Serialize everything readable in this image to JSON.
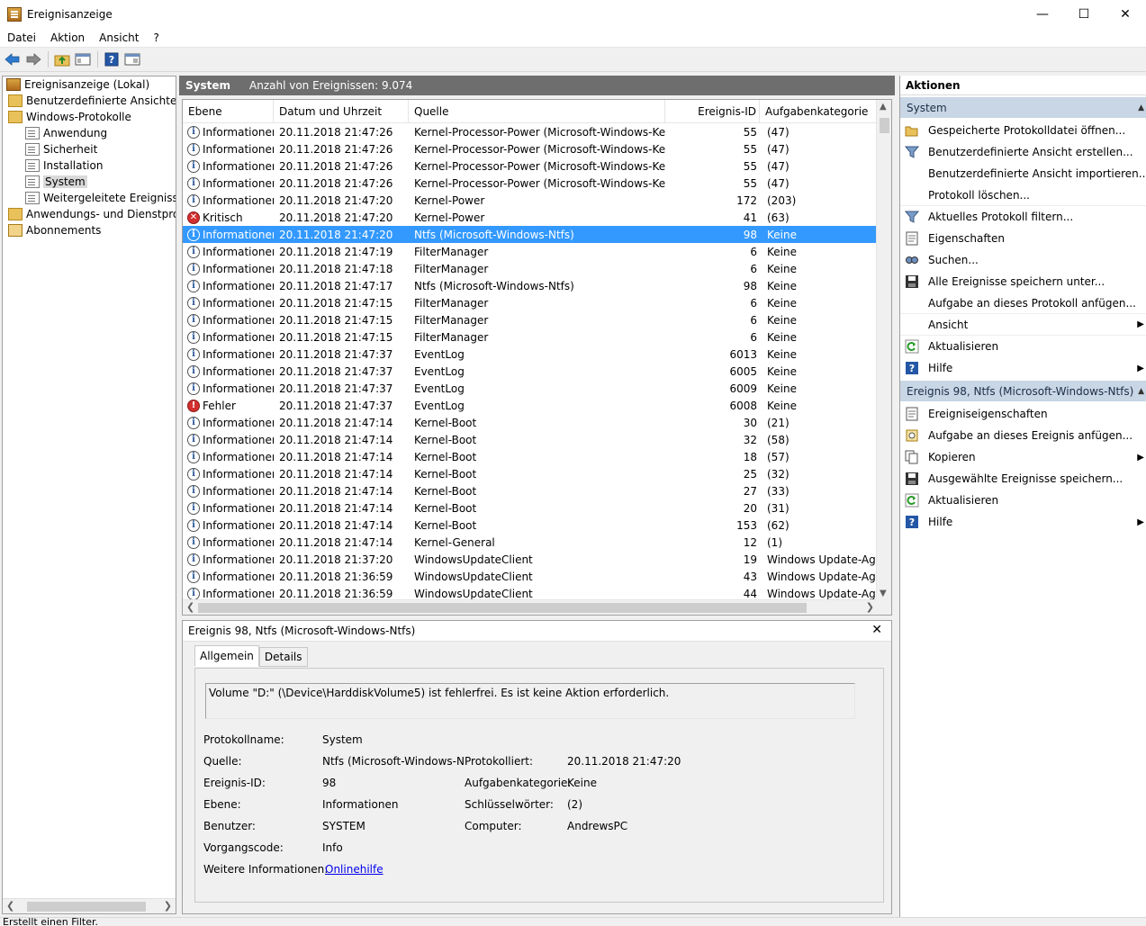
{
  "window": {
    "title": "Ereignisanzeige",
    "minimize": "—",
    "maximize": "☐",
    "close": "✕"
  },
  "menu": [
    "Datei",
    "Aktion",
    "Ansicht",
    "?"
  ],
  "tree": [
    {
      "label": "Ereignisanzeige (Lokal)",
      "indent": 0,
      "icon": "eventviewer-icon"
    },
    {
      "label": "Benutzerdefinierte Ansichten",
      "indent": 1,
      "icon": "folder-icon"
    },
    {
      "label": "Windows-Protokolle",
      "indent": 1,
      "icon": "folder-icon"
    },
    {
      "label": "Anwendung",
      "indent": 2,
      "icon": "log-icon"
    },
    {
      "label": "Sicherheit",
      "indent": 2,
      "icon": "log-icon"
    },
    {
      "label": "Installation",
      "indent": 2,
      "icon": "log-icon"
    },
    {
      "label": "System",
      "indent": 2,
      "icon": "log-icon",
      "selected": true
    },
    {
      "label": "Weitergeleitete Ereignisse",
      "indent": 2,
      "icon": "log-icon"
    },
    {
      "label": "Anwendungs- und Dienstprotokolle",
      "indent": 1,
      "icon": "folder-icon"
    },
    {
      "label": "Abonnements",
      "indent": 1,
      "icon": "subscription-icon"
    }
  ],
  "center": {
    "log_name": "System",
    "count_text": "Anzahl von Ereignissen: 9.074"
  },
  "columns": [
    "Ebene",
    "Datum und Uhrzeit",
    "Quelle",
    "Ereignis-ID",
    "Aufgabenkategorie"
  ],
  "events": [
    {
      "level": "Informationen",
      "type": "info",
      "date": "20.11.2018 21:47:26",
      "source": "Kernel-Processor-Power (Microsoft-Windows-Ker...",
      "id": "55",
      "category": "(47)"
    },
    {
      "level": "Informationen",
      "type": "info",
      "date": "20.11.2018 21:47:26",
      "source": "Kernel-Processor-Power (Microsoft-Windows-Ker...",
      "id": "55",
      "category": "(47)"
    },
    {
      "level": "Informationen",
      "type": "info",
      "date": "20.11.2018 21:47:26",
      "source": "Kernel-Processor-Power (Microsoft-Windows-Ker...",
      "id": "55",
      "category": "(47)"
    },
    {
      "level": "Informationen",
      "type": "info",
      "date": "20.11.2018 21:47:26",
      "source": "Kernel-Processor-Power (Microsoft-Windows-Ker...",
      "id": "55",
      "category": "(47)"
    },
    {
      "level": "Informationen",
      "type": "info",
      "date": "20.11.2018 21:47:20",
      "source": "Kernel-Power",
      "id": "172",
      "category": "(203)"
    },
    {
      "level": "Kritisch",
      "type": "critical",
      "date": "20.11.2018 21:47:20",
      "source": "Kernel-Power",
      "id": "41",
      "category": "(63)"
    },
    {
      "level": "Informationen",
      "type": "info",
      "date": "20.11.2018 21:47:20",
      "source": "Ntfs (Microsoft-Windows-Ntfs)",
      "id": "98",
      "category": "Keine",
      "selected": true
    },
    {
      "level": "Informationen",
      "type": "info",
      "date": "20.11.2018 21:47:19",
      "source": "FilterManager",
      "id": "6",
      "category": "Keine"
    },
    {
      "level": "Informationen",
      "type": "info",
      "date": "20.11.2018 21:47:18",
      "source": "FilterManager",
      "id": "6",
      "category": "Keine"
    },
    {
      "level": "Informationen",
      "type": "info",
      "date": "20.11.2018 21:47:17",
      "source": "Ntfs (Microsoft-Windows-Ntfs)",
      "id": "98",
      "category": "Keine"
    },
    {
      "level": "Informationen",
      "type": "info",
      "date": "20.11.2018 21:47:15",
      "source": "FilterManager",
      "id": "6",
      "category": "Keine"
    },
    {
      "level": "Informationen",
      "type": "info",
      "date": "20.11.2018 21:47:15",
      "source": "FilterManager",
      "id": "6",
      "category": "Keine"
    },
    {
      "level": "Informationen",
      "type": "info",
      "date": "20.11.2018 21:47:15",
      "source": "FilterManager",
      "id": "6",
      "category": "Keine"
    },
    {
      "level": "Informationen",
      "type": "info",
      "date": "20.11.2018 21:47:37",
      "source": "EventLog",
      "id": "6013",
      "category": "Keine"
    },
    {
      "level": "Informationen",
      "type": "info",
      "date": "20.11.2018 21:47:37",
      "source": "EventLog",
      "id": "6005",
      "category": "Keine"
    },
    {
      "level": "Informationen",
      "type": "info",
      "date": "20.11.2018 21:47:37",
      "source": "EventLog",
      "id": "6009",
      "category": "Keine"
    },
    {
      "level": "Fehler",
      "type": "error",
      "date": "20.11.2018 21:47:37",
      "source": "EventLog",
      "id": "6008",
      "category": "Keine"
    },
    {
      "level": "Informationen",
      "type": "info",
      "date": "20.11.2018 21:47:14",
      "source": "Kernel-Boot",
      "id": "30",
      "category": "(21)"
    },
    {
      "level": "Informationen",
      "type": "info",
      "date": "20.11.2018 21:47:14",
      "source": "Kernel-Boot",
      "id": "32",
      "category": "(58)"
    },
    {
      "level": "Informationen",
      "type": "info",
      "date": "20.11.2018 21:47:14",
      "source": "Kernel-Boot",
      "id": "18",
      "category": "(57)"
    },
    {
      "level": "Informationen",
      "type": "info",
      "date": "20.11.2018 21:47:14",
      "source": "Kernel-Boot",
      "id": "25",
      "category": "(32)"
    },
    {
      "level": "Informationen",
      "type": "info",
      "date": "20.11.2018 21:47:14",
      "source": "Kernel-Boot",
      "id": "27",
      "category": "(33)"
    },
    {
      "level": "Informationen",
      "type": "info",
      "date": "20.11.2018 21:47:14",
      "source": "Kernel-Boot",
      "id": "20",
      "category": "(31)"
    },
    {
      "level": "Informationen",
      "type": "info",
      "date": "20.11.2018 21:47:14",
      "source": "Kernel-Boot",
      "id": "153",
      "category": "(62)"
    },
    {
      "level": "Informationen",
      "type": "info",
      "date": "20.11.2018 21:47:14",
      "source": "Kernel-General",
      "id": "12",
      "category": "(1)"
    },
    {
      "level": "Informationen",
      "type": "info",
      "date": "20.11.2018 21:37:20",
      "source": "WindowsUpdateClient",
      "id": "19",
      "category": "Windows Update-Ager"
    },
    {
      "level": "Informationen",
      "type": "info",
      "date": "20.11.2018 21:36:59",
      "source": "WindowsUpdateClient",
      "id": "43",
      "category": "Windows Update-Ager"
    },
    {
      "level": "Informationen",
      "type": "info",
      "date": "20.11.2018 21:36:59",
      "source": "WindowsUpdateClient",
      "id": "44",
      "category": "Windows Update-Ager"
    }
  ],
  "detail": {
    "title": "Ereignis 98, Ntfs (Microsoft-Windows-Ntfs)",
    "tabs": [
      "Allgemein",
      "Details"
    ],
    "message": "Volume \"D:\" (\\Device\\HarddiskVolume5) ist fehlerfrei. Es ist keine Aktion erforderlich.",
    "labels": {
      "logname": "Protokollname:",
      "source": "Quelle:",
      "eventid": "Ereignis-ID:",
      "level": "Ebene:",
      "user": "Benutzer:",
      "opcode": "Vorgangscode:",
      "moreinfo": "Weitere Informationen:",
      "logged": "Protokolliert:",
      "taskcat": "Aufgabenkategorie:",
      "keywords": "Schlüsselwörter:",
      "computer": "Computer:"
    },
    "values": {
      "logname": "System",
      "source": "Ntfs (Microsoft-Windows-N",
      "eventid": "98",
      "level": "Informationen",
      "user": "SYSTEM",
      "opcode": "Info",
      "moreinfo": "Onlinehilfe",
      "logged": "20.11.2018 21:47:20",
      "taskcat": "Keine",
      "keywords": "(2)",
      "computer": "AndrewsPC"
    }
  },
  "actions": {
    "title": "Aktionen",
    "section1": "System",
    "items1": [
      {
        "label": "Gespeicherte Protokolldatei öffnen...",
        "icon": "open-folder-icon"
      },
      {
        "label": "Benutzerdefinierte Ansicht erstellen...",
        "icon": "filter-icon"
      },
      {
        "label": "Benutzerdefinierte Ansicht importieren...",
        "icon": ""
      },
      {
        "label": "Protokoll löschen...",
        "icon": "",
        "sep": true
      },
      {
        "label": "Aktuelles Protokoll filtern...",
        "icon": "filter-icon"
      },
      {
        "label": "Eigenschaften",
        "icon": "properties-icon"
      },
      {
        "label": "Suchen...",
        "icon": "find-icon"
      },
      {
        "label": "Alle Ereignisse speichern unter...",
        "icon": "save-icon"
      },
      {
        "label": "Aufgabe an dieses Protokoll anfügen...",
        "icon": "",
        "sep": true
      },
      {
        "label": "Ansicht",
        "icon": "",
        "submenu": true,
        "sep": true
      },
      {
        "label": "Aktualisieren",
        "icon": "refresh-icon"
      },
      {
        "label": "Hilfe",
        "icon": "help-icon",
        "submenu": true
      }
    ],
    "section2": "Ereignis 98, Ntfs (Microsoft-Windows-Ntfs)",
    "items2": [
      {
        "label": "Ereigniseigenschaften",
        "icon": "properties-icon"
      },
      {
        "label": "Aufgabe an dieses Ereignis anfügen...",
        "icon": "task-icon"
      },
      {
        "label": "Kopieren",
        "icon": "copy-icon",
        "submenu": true
      },
      {
        "label": "Ausgewählte Ereignisse speichern...",
        "icon": "save-icon"
      },
      {
        "label": "Aktualisieren",
        "icon": "refresh-icon"
      },
      {
        "label": "Hilfe",
        "icon": "help-icon",
        "submenu": true
      }
    ]
  },
  "status": "Erstellt einen Filter."
}
